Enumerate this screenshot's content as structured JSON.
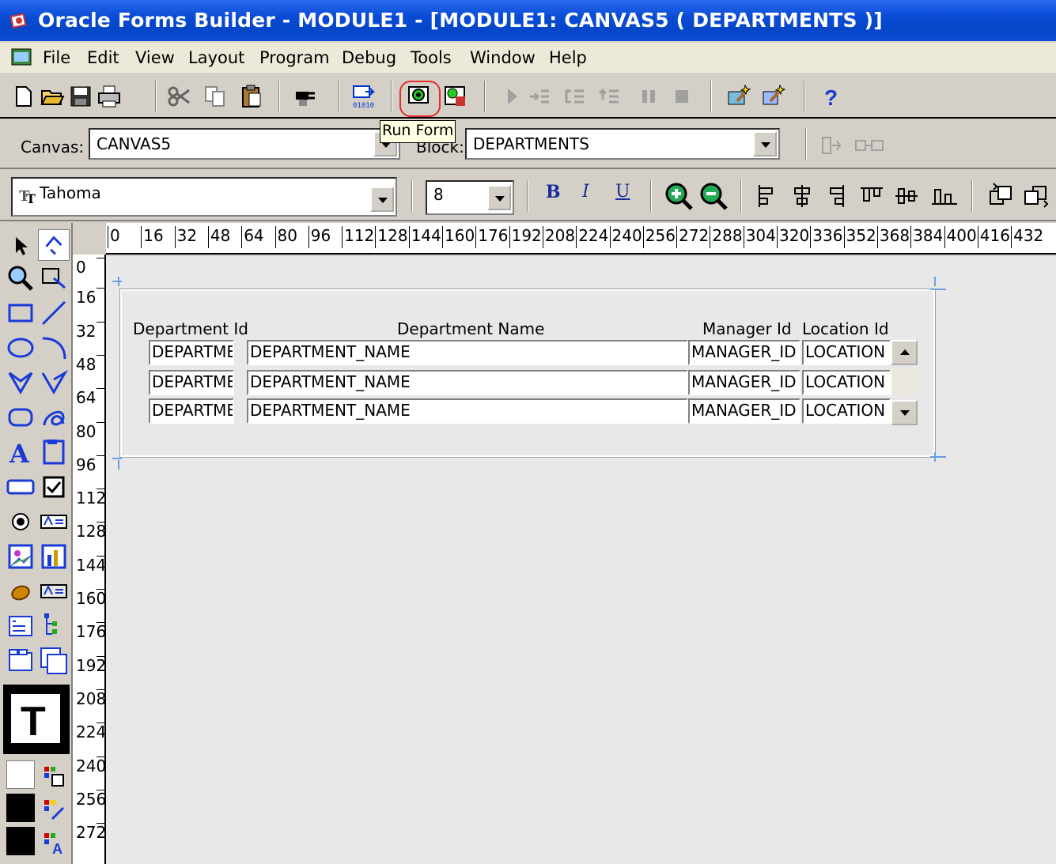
{
  "window": {
    "title": "Oracle Forms Builder - MODULE1 - [MODULE1: CANVAS5 ( DEPARTMENTS )]"
  },
  "menubar": {
    "items": [
      "File",
      "Edit",
      "View",
      "Layout",
      "Program",
      "Debug",
      "Tools",
      "Window",
      "Help"
    ]
  },
  "toolbar": {
    "tooltip": "Run Form",
    "icons": [
      "new-icon",
      "open-icon",
      "save-icon",
      "print-icon",
      "cut-icon",
      "copy-icon",
      "paste-icon",
      "connect-icon",
      "compile-module-icon",
      "run-form-icon",
      "run-form-debug-icon",
      "go-icon",
      "step-into-icon",
      "step-over-icon",
      "step-out-icon",
      "pause-icon",
      "stop-icon",
      "layout-wizard-icon",
      "data-block-wizard-icon",
      "help-icon"
    ]
  },
  "context": {
    "canvas_label": "Canvas:",
    "canvas_value": "CANVAS5",
    "block_label": "Block:",
    "block_value": "DEPARTMENTS"
  },
  "format": {
    "font_name": "Tahoma",
    "font_size": "8",
    "bold": "B",
    "italic": "I",
    "underline": "U"
  },
  "ruler": {
    "h_ticks": [
      "0",
      "16",
      "32",
      "48",
      "64",
      "80",
      "96",
      "112",
      "128",
      "144",
      "160",
      "176",
      "192",
      "208",
      "224",
      "240",
      "256",
      "272",
      "288",
      "304",
      "320",
      "336",
      "352",
      "368",
      "384",
      "400",
      "416",
      "432"
    ],
    "v_ticks": [
      "0",
      "16",
      "32",
      "48",
      "64",
      "80",
      "96",
      "112",
      "128",
      "144",
      "160",
      "176",
      "192",
      "208",
      "224",
      "240",
      "256",
      "272"
    ]
  },
  "form": {
    "headers": {
      "dept_id": "Department Id",
      "dept_name": "Department Name",
      "manager_id": "Manager Id",
      "location_id": "Location Id"
    },
    "rows": [
      {
        "dept_id": "DEPARTME",
        "dept_name": "DEPARTMENT_NAME",
        "manager_id": "MANAGER_ID",
        "location_id": "LOCATION"
      },
      {
        "dept_id": "DEPARTME",
        "dept_name": "DEPARTMENT_NAME",
        "manager_id": "MANAGER_ID",
        "location_id": "LOCATION"
      },
      {
        "dept_id": "DEPARTME",
        "dept_name": "DEPARTMENT_NAME",
        "manager_id": "MANAGER_ID",
        "location_id": "LOCATION"
      }
    ]
  },
  "colors": {
    "title_bar": "#0a4bd6",
    "highlight": "#e52a2a",
    "tooltip_bg": "#ffffe1"
  }
}
